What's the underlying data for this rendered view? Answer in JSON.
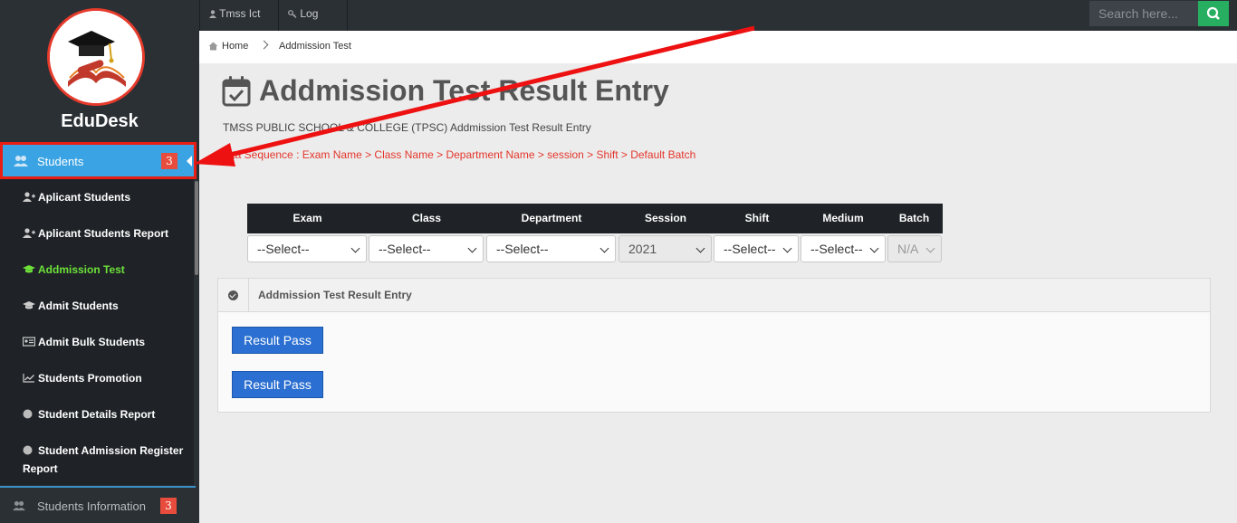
{
  "app": {
    "brand": "EduDesk"
  },
  "topbar": {
    "user_label": "Tmss Ict",
    "logout_label": "Log Out",
    "search_placeholder": "Search here..."
  },
  "breadcrumb": {
    "home": "Home",
    "current": "Addmission Test"
  },
  "sidebar": {
    "active_section": {
      "label": "Students",
      "badge": "3"
    },
    "items": [
      {
        "label": "Aplicant Students",
        "icon": "user-plus-icon"
      },
      {
        "label": "Aplicant Students Report",
        "icon": "user-plus-icon"
      },
      {
        "label": "Addmission Test",
        "icon": "graduation-cap-icon",
        "active": true
      },
      {
        "label": "Admit Students",
        "icon": "graduation-cap-icon"
      },
      {
        "label": "Admit Bulk Students",
        "icon": "id-card-icon"
      },
      {
        "label": "Students Promotion",
        "icon": "line-chart-icon"
      },
      {
        "label": "Student Details Report",
        "icon": "circle-icon"
      },
      {
        "label": "Student Admission Register Report",
        "icon": "circle-icon"
      }
    ],
    "next_section": {
      "label": "Students Information",
      "badge": "3"
    }
  },
  "page": {
    "title": "Addmission Test Result Entry",
    "subtitle": "TMSS PUBLIC SCHOOL & COLLEGE (TPSC) Addmission Test Result Entry",
    "sequence": "Data Sequence : Exam Name > Class Name > Department Name > session > Shift > Default Batch"
  },
  "filters": {
    "columns": [
      "Exam",
      "Class",
      "Department",
      "Session",
      "Shift",
      "Medium",
      "Batch"
    ],
    "values": [
      "--Select--",
      "--Select--",
      "--Select--",
      "2021",
      "--Select--",
      "--Select--",
      "N/A"
    ]
  },
  "panel": {
    "title": "Addmission Test Result Entry",
    "buttons": [
      "Result Pass",
      "Result Pass"
    ]
  },
  "colors": {
    "sidebar_bg": "#2b3035",
    "active_nav": "#3aa3e3",
    "highlight_red": "#e81d14",
    "active_subitem": "#6de13a",
    "primary_button": "#2a6fd1",
    "search_button": "#27ae60"
  }
}
